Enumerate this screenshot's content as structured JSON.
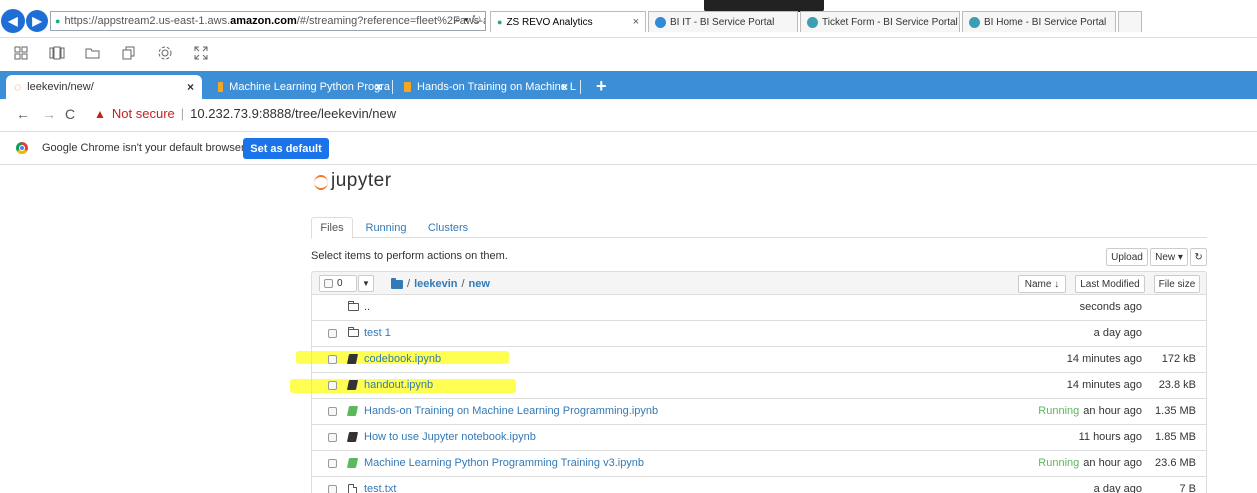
{
  "ie": {
    "url_prefix": "https://appstream2.us-east-1.aws.",
    "url_domain": "amazon.com",
    "url_suffix": "/#/streaming?reference=fleet%2Faws-a0",
    "url_controls": "⌕ ▾ ↻",
    "tabs": [
      {
        "label": "ZS REVO Analytics",
        "close": "×"
      },
      {
        "label": "BI IT - BI Service Portal"
      },
      {
        "label": "Ticket Form - BI Service Portal"
      },
      {
        "label": "BI Home - BI Service Portal"
      }
    ]
  },
  "chrome": {
    "tabs": [
      {
        "label": "leekevin/new/",
        "close": "×"
      },
      {
        "label": "Machine Learning Python Progra",
        "close": "×"
      },
      {
        "label": "Hands-on Training on Machine L",
        "close": "×"
      }
    ],
    "new_tab": "+",
    "not_secure": "Not secure",
    "url": "10.232.73.9:8888/tree/leekevin/new",
    "infobar_text": "Google Chrome isn't your default browser",
    "set_default": "Set as default"
  },
  "jupyter": {
    "logo_text": "jupyter",
    "tabs": [
      "Files",
      "Running",
      "Clusters"
    ],
    "select_text": "Select items to perform actions on them.",
    "upload": "Upload",
    "new": "New ▾",
    "refresh": "↻",
    "selected_count": "0",
    "breadcrumb": [
      "leekevin",
      "new"
    ],
    "sort_name": "Name ↓",
    "sort_modified": "Last Modified",
    "sort_size": "File size",
    "running_label": "Running",
    "files": [
      {
        "name": "..",
        "type": "folder",
        "modified": "seconds ago",
        "size": "",
        "running": false,
        "checkbox": false
      },
      {
        "name": "test 1",
        "type": "folder",
        "modified": "a day ago",
        "size": "",
        "running": false,
        "checkbox": true
      },
      {
        "name": "codebook.ipynb",
        "type": "notebook",
        "modified": "14 minutes ago",
        "size": "172 kB",
        "running": false,
        "checkbox": true
      },
      {
        "name": "handout.ipynb",
        "type": "notebook",
        "modified": "14 minutes ago",
        "size": "23.8 kB",
        "running": false,
        "checkbox": true
      },
      {
        "name": "Hands-on Training on Machine Learning Programming.ipynb",
        "type": "notebook",
        "modified": "an hour ago",
        "size": "1.35 MB",
        "running": true,
        "checkbox": true
      },
      {
        "name": "How to use Jupyter notebook.ipynb",
        "type": "notebook",
        "modified": "11 hours ago",
        "size": "1.85 MB",
        "running": false,
        "checkbox": true
      },
      {
        "name": "Machine Learning Python Programming Training v3.ipynb",
        "type": "notebook",
        "modified": "an hour ago",
        "size": "23.6 MB",
        "running": true,
        "checkbox": true
      },
      {
        "name": "test.txt",
        "type": "file",
        "modified": "a day ago",
        "size": "7 B",
        "running": false,
        "checkbox": true
      }
    ]
  },
  "colors": {
    "link": "#337ab7",
    "running": "#5cb85c",
    "chrome_tabstrip": "#3c8fd6",
    "highlight": "#ffff33",
    "jupyter_orange": "#f37726"
  }
}
